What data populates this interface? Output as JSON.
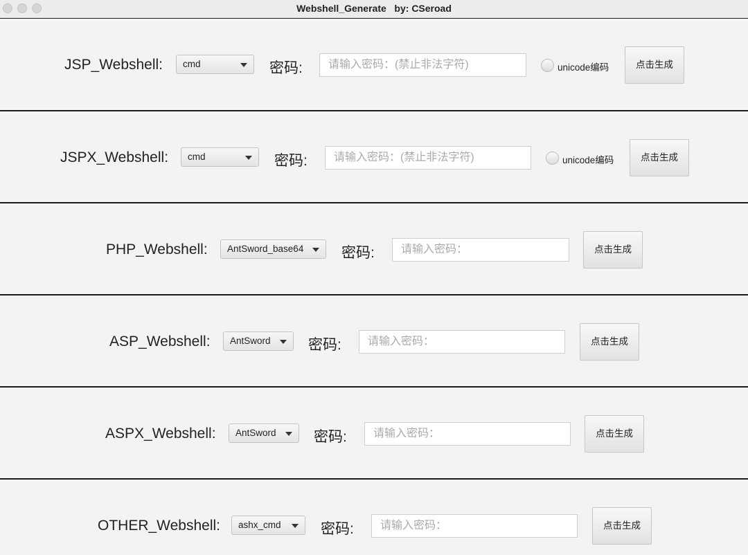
{
  "window": {
    "title": "Webshell_Generate   by: CSeroad"
  },
  "rows": [
    {
      "label": "JSP_Webshell:",
      "select_value": "cmd",
      "password_label": "密码:",
      "password_placeholder": "请输入密码：(禁止非法字符)",
      "unicode_label": "unicode编码",
      "button_label": "点击生成"
    },
    {
      "label": "JSPX_Webshell:",
      "select_value": "cmd",
      "password_label": "密码:",
      "password_placeholder": "请输入密码：(禁止非法字符)",
      "unicode_label": "unicode编码",
      "button_label": "点击生成"
    },
    {
      "label": "PHP_Webshell:",
      "select_value": "AntSword_base64",
      "password_label": "密码:",
      "password_placeholder": "请输入密码：",
      "button_label": "点击生成"
    },
    {
      "label": "ASP_Webshell:",
      "select_value": "AntSword",
      "password_label": "密码:",
      "password_placeholder": "请输入密码：",
      "button_label": "点击生成"
    },
    {
      "label": "ASPX_Webshell:",
      "select_value": "AntSword",
      "password_label": "密码:",
      "password_placeholder": "请输入密码：",
      "button_label": "点击生成"
    },
    {
      "label": "OTHER_Webshell:",
      "select_value": "ashx_cmd",
      "password_label": "密码:",
      "password_placeholder": "请输入密码：",
      "button_label": "点击生成"
    }
  ]
}
